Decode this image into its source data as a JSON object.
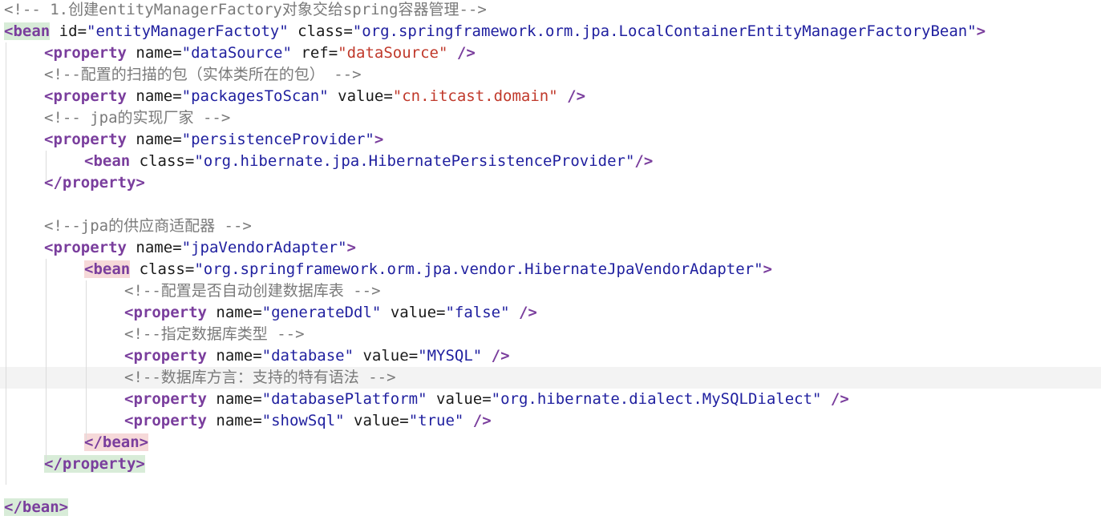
{
  "editor": {
    "lines": [
      {
        "indent": 0,
        "kind": "comment",
        "text": "<!-- 1.创建entityManagerFactory对象交给spring容器管理-->"
      },
      {
        "indent": 0,
        "kind": "tag",
        "tag_open": "<",
        "name": "bean",
        "hl": "green",
        "attrs": [
          {
            "n": "id",
            "v": "\"entityManagerFactoty\""
          },
          {
            "n": "class",
            "v": "\"org.springframework.orm.jpa.LocalContainerEntityManagerFactoryBean\""
          }
        ],
        "close": ">"
      },
      {
        "indent": 1,
        "kind": "tag",
        "tag_open": "<",
        "name": "property",
        "attrs": [
          {
            "n": "name",
            "v": "\"dataSource\""
          },
          {
            "n": "ref",
            "v": "\"dataSource\"",
            "red": true
          }
        ],
        "close": " />"
      },
      {
        "indent": 1,
        "kind": "comment",
        "text": "<!--配置的扫描的包（实体类所在的包） -->"
      },
      {
        "indent": 1,
        "kind": "tag",
        "tag_open": "<",
        "name": "property",
        "attrs": [
          {
            "n": "name",
            "v": "\"packagesToScan\""
          },
          {
            "n": "value",
            "v": "\"cn.itcast.domain\"",
            "red": true
          }
        ],
        "close": " />"
      },
      {
        "indent": 1,
        "kind": "comment",
        "text": "<!-- jpa的实现厂家 -->"
      },
      {
        "indent": 1,
        "kind": "tag",
        "tag_open": "<",
        "name": "property",
        "attrs": [
          {
            "n": "name",
            "v": "\"persistenceProvider\""
          }
        ],
        "close": ">"
      },
      {
        "indent": 2,
        "kind": "tag",
        "tag_open": "<",
        "name": "bean",
        "attrs": [
          {
            "n": "class",
            "v": "\"org.hibernate.jpa.HibernatePersistenceProvider\""
          }
        ],
        "close": "/>"
      },
      {
        "indent": 1,
        "kind": "tag",
        "tag_open": "</",
        "name": "property",
        "attrs": [],
        "close": ">"
      },
      {
        "indent": 0,
        "kind": "blank",
        "text": ""
      },
      {
        "indent": 1,
        "kind": "comment",
        "text": "<!--jpa的供应商适配器 -->"
      },
      {
        "indent": 1,
        "kind": "tag",
        "tag_open": "<",
        "name": "property",
        "attrs": [
          {
            "n": "name",
            "v": "\"jpaVendorAdapter\""
          }
        ],
        "close": ">"
      },
      {
        "indent": 2,
        "kind": "tag",
        "tag_open": "<",
        "name": "bean",
        "hl": "pink",
        "attrs": [
          {
            "n": "class",
            "v": "\"org.springframework.orm.jpa.vendor.HibernateJpaVendorAdapter\""
          }
        ],
        "close": ">"
      },
      {
        "indent": 3,
        "kind": "comment",
        "text": "<!--配置是否自动创建数据库表 -->"
      },
      {
        "indent": 3,
        "kind": "tag",
        "tag_open": "<",
        "name": "property",
        "attrs": [
          {
            "n": "name",
            "v": "\"generateDdl\""
          },
          {
            "n": "value",
            "v": "\"false\""
          }
        ],
        "close": " />"
      },
      {
        "indent": 3,
        "kind": "comment",
        "text": "<!--指定数据库类型 -->"
      },
      {
        "indent": 3,
        "kind": "tag",
        "tag_open": "<",
        "name": "property",
        "attrs": [
          {
            "n": "name",
            "v": "\"database\""
          },
          {
            "n": "value",
            "v": "\"MYSQL\""
          }
        ],
        "close": " />"
      },
      {
        "indent": 3,
        "kind": "comment",
        "text": "<!--数据库方言：支持的特有语法 -->",
        "current": true
      },
      {
        "indent": 3,
        "kind": "tag",
        "tag_open": "<",
        "name": "property",
        "attrs": [
          {
            "n": "name",
            "v": "\"databasePlatform\""
          },
          {
            "n": "value",
            "v": "\"org.hibernate.dialect.MySQLDialect\""
          }
        ],
        "close": " />"
      },
      {
        "indent": 3,
        "kind": "tag",
        "tag_open": "<",
        "name": "property",
        "attrs": [
          {
            "n": "name",
            "v": "\"showSql\""
          },
          {
            "n": "value",
            "v": "\"true\""
          }
        ],
        "close": " />"
      },
      {
        "indent": 2,
        "kind": "tag",
        "tag_open": "</",
        "name": "bean",
        "hl": "pink",
        "attrs": [],
        "close": ">"
      },
      {
        "indent": 1,
        "kind": "tag",
        "tag_open": "</",
        "name": "property",
        "hl": "green",
        "attrs": [],
        "close": ">"
      },
      {
        "indent": 0,
        "kind": "blank",
        "text": ""
      },
      {
        "indent": 0,
        "kind": "tag",
        "tag_open": "</",
        "name": "bean",
        "hl": "green",
        "attrs": [],
        "close": ">"
      }
    ]
  },
  "colors": {
    "comment": "#7a7a7a",
    "tag": "#7a3e9d",
    "value": "#1f1f9f",
    "ref_value": "#c0392b",
    "current_line": "#f3f3f3"
  }
}
